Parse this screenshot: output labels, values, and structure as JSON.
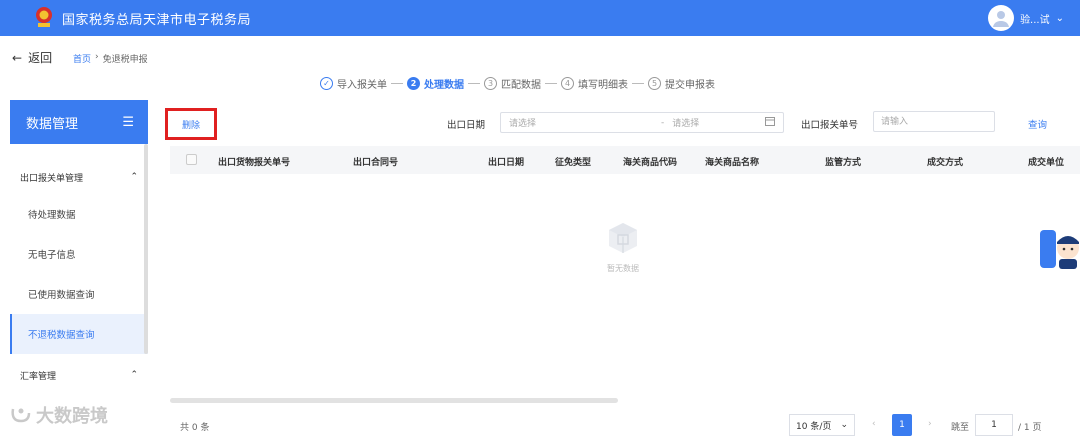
{
  "header": {
    "title": "国家税务总局天津市电子税务局",
    "user_name": "验...试"
  },
  "nav": {
    "back_label": "返回",
    "breadcrumb": [
      "首页",
      "免退税申报"
    ]
  },
  "steps": [
    {
      "num": "✓",
      "label": "导入报关单",
      "state": "done"
    },
    {
      "num": "2",
      "label": "处理数据",
      "state": "active"
    },
    {
      "num": "3",
      "label": "匹配数据",
      "state": "todo"
    },
    {
      "num": "4",
      "label": "填写明细表",
      "state": "todo"
    },
    {
      "num": "5",
      "label": "提交申报表",
      "state": "todo"
    }
  ],
  "sidebar": {
    "title": "数据管理",
    "groups": [
      {
        "label": "出口报关单管理",
        "items": [
          "待处理数据",
          "无电子信息",
          "已使用数据查询",
          "不退税数据查询"
        ]
      },
      {
        "label": "汇率管理",
        "items": []
      }
    ],
    "active_item": "不退税数据查询"
  },
  "toolbar": {
    "delete_label": "删除",
    "date_label": "出口日期",
    "date_start_placeholder": "请选择",
    "date_end_placeholder": "请选择",
    "date_separator": "-",
    "customs_no_label": "出口报关单号",
    "customs_no_placeholder": "请输入",
    "query_label": "查询"
  },
  "table": {
    "columns": [
      "出口货物报关单号",
      "出口合同号",
      "出口日期",
      "征免类型",
      "海关商品代码",
      "海关商品名称",
      "监管方式",
      "成交方式",
      "成交单位"
    ],
    "empty_text": "暂无数据"
  },
  "pagination": {
    "total_text": "共 0 条",
    "page_size": "10 条/页",
    "current_page": "1",
    "jump_label": "跳至",
    "jump_value": "1",
    "pages_text": "/ 1 页"
  },
  "watermark": "大数跨境",
  "colors": {
    "primary": "#3a7cf0",
    "highlight_box": "#e02020"
  }
}
